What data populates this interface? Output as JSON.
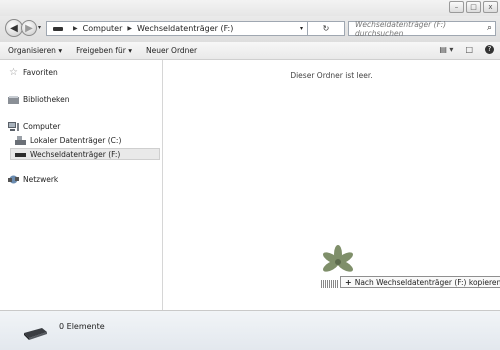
{
  "window": {
    "minimize_glyph": "–",
    "maximize_glyph": "□",
    "close_glyph": "x"
  },
  "navigation": {
    "back_glyph": "◀",
    "forward_glyph": "▶",
    "breadcrumb": [
      "Computer",
      "Wechseldatenträger (F:)"
    ],
    "search_placeholder": "Wechseldatenträger (F:) durchsuchen"
  },
  "toolbar": {
    "organize_label": "Organisieren ▾",
    "share_label": "Freigeben für ▾",
    "new_folder_label": "Neuer Ordner"
  },
  "sidebar": {
    "favorites": "Favoriten",
    "libraries": "Bibliotheken",
    "computer": "Computer",
    "local_disk": "Lokaler Datenträger (C:)",
    "removable_disk": "Wechseldatenträger (F:)",
    "network": "Netzwerk"
  },
  "main": {
    "empty_message": "Dieser Ordner ist leer.",
    "drag_tooltip": "Nach Wechseldatenträger (F:) kopieren"
  },
  "status": {
    "item_count": "0 Elemente"
  },
  "icons": [
    "back-icon",
    "forward-icon",
    "drive-icon",
    "breadcrumb-arrow-icon",
    "refresh-icon",
    "search-icon",
    "view-options-icon",
    "preview-pane-icon",
    "help-icon",
    "star-icon",
    "library-icon",
    "computer-icon",
    "disk-icon",
    "network-icon",
    "flower-image-icon",
    "copy-plus-icon"
  ]
}
